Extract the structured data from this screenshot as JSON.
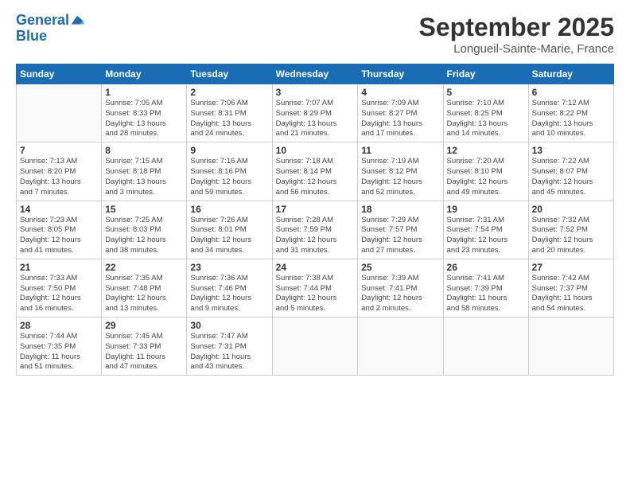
{
  "header": {
    "logo_line1": "General",
    "logo_line2": "Blue",
    "month": "September 2025",
    "location": "Longueil-Sainte-Marie, France"
  },
  "weekdays": [
    "Sunday",
    "Monday",
    "Tuesday",
    "Wednesday",
    "Thursday",
    "Friday",
    "Saturday"
  ],
  "weeks": [
    [
      {
        "day": "",
        "info": ""
      },
      {
        "day": "1",
        "info": "Sunrise: 7:05 AM\nSunset: 8:33 PM\nDaylight: 13 hours\nand 28 minutes."
      },
      {
        "day": "2",
        "info": "Sunrise: 7:06 AM\nSunset: 8:31 PM\nDaylight: 13 hours\nand 24 minutes."
      },
      {
        "day": "3",
        "info": "Sunrise: 7:07 AM\nSunset: 8:29 PM\nDaylight: 13 hours\nand 21 minutes."
      },
      {
        "day": "4",
        "info": "Sunrise: 7:09 AM\nSunset: 8:27 PM\nDaylight: 13 hours\nand 17 minutes."
      },
      {
        "day": "5",
        "info": "Sunrise: 7:10 AM\nSunset: 8:25 PM\nDaylight: 13 hours\nand 14 minutes."
      },
      {
        "day": "6",
        "info": "Sunrise: 7:12 AM\nSunset: 8:22 PM\nDaylight: 13 hours\nand 10 minutes."
      }
    ],
    [
      {
        "day": "7",
        "info": "Sunrise: 7:13 AM\nSunset: 8:20 PM\nDaylight: 13 hours\nand 7 minutes."
      },
      {
        "day": "8",
        "info": "Sunrise: 7:15 AM\nSunset: 8:18 PM\nDaylight: 13 hours\nand 3 minutes."
      },
      {
        "day": "9",
        "info": "Sunrise: 7:16 AM\nSunset: 8:16 PM\nDaylight: 12 hours\nand 59 minutes."
      },
      {
        "day": "10",
        "info": "Sunrise: 7:18 AM\nSunset: 8:14 PM\nDaylight: 12 hours\nand 56 minutes."
      },
      {
        "day": "11",
        "info": "Sunrise: 7:19 AM\nSunset: 8:12 PM\nDaylight: 12 hours\nand 52 minutes."
      },
      {
        "day": "12",
        "info": "Sunrise: 7:20 AM\nSunset: 8:10 PM\nDaylight: 12 hours\nand 49 minutes."
      },
      {
        "day": "13",
        "info": "Sunrise: 7:22 AM\nSunset: 8:07 PM\nDaylight: 12 hours\nand 45 minutes."
      }
    ],
    [
      {
        "day": "14",
        "info": "Sunrise: 7:23 AM\nSunset: 8:05 PM\nDaylight: 12 hours\nand 41 minutes."
      },
      {
        "day": "15",
        "info": "Sunrise: 7:25 AM\nSunset: 8:03 PM\nDaylight: 12 hours\nand 38 minutes."
      },
      {
        "day": "16",
        "info": "Sunrise: 7:26 AM\nSunset: 8:01 PM\nDaylight: 12 hours\nand 34 minutes."
      },
      {
        "day": "17",
        "info": "Sunrise: 7:28 AM\nSunset: 7:59 PM\nDaylight: 12 hours\nand 31 minutes."
      },
      {
        "day": "18",
        "info": "Sunrise: 7:29 AM\nSunset: 7:57 PM\nDaylight: 12 hours\nand 27 minutes."
      },
      {
        "day": "19",
        "info": "Sunrise: 7:31 AM\nSunset: 7:54 PM\nDaylight: 12 hours\nand 23 minutes."
      },
      {
        "day": "20",
        "info": "Sunrise: 7:32 AM\nSunset: 7:52 PM\nDaylight: 12 hours\nand 20 minutes."
      }
    ],
    [
      {
        "day": "21",
        "info": "Sunrise: 7:33 AM\nSunset: 7:50 PM\nDaylight: 12 hours\nand 16 minutes."
      },
      {
        "day": "22",
        "info": "Sunrise: 7:35 AM\nSunset: 7:48 PM\nDaylight: 12 hours\nand 13 minutes."
      },
      {
        "day": "23",
        "info": "Sunrise: 7:36 AM\nSunset: 7:46 PM\nDaylight: 12 hours\nand 9 minutes."
      },
      {
        "day": "24",
        "info": "Sunrise: 7:38 AM\nSunset: 7:44 PM\nDaylight: 12 hours\nand 5 minutes."
      },
      {
        "day": "25",
        "info": "Sunrise: 7:39 AM\nSunset: 7:41 PM\nDaylight: 12 hours\nand 2 minutes."
      },
      {
        "day": "26",
        "info": "Sunrise: 7:41 AM\nSunset: 7:39 PM\nDaylight: 11 hours\nand 58 minutes."
      },
      {
        "day": "27",
        "info": "Sunrise: 7:42 AM\nSunset: 7:37 PM\nDaylight: 11 hours\nand 54 minutes."
      }
    ],
    [
      {
        "day": "28",
        "info": "Sunrise: 7:44 AM\nSunset: 7:35 PM\nDaylight: 11 hours\nand 51 minutes."
      },
      {
        "day": "29",
        "info": "Sunrise: 7:45 AM\nSunset: 7:33 PM\nDaylight: 11 hours\nand 47 minutes."
      },
      {
        "day": "30",
        "info": "Sunrise: 7:47 AM\nSunset: 7:31 PM\nDaylight: 11 hours\nand 43 minutes."
      },
      {
        "day": "",
        "info": ""
      },
      {
        "day": "",
        "info": ""
      },
      {
        "day": "",
        "info": ""
      },
      {
        "day": "",
        "info": ""
      }
    ]
  ]
}
